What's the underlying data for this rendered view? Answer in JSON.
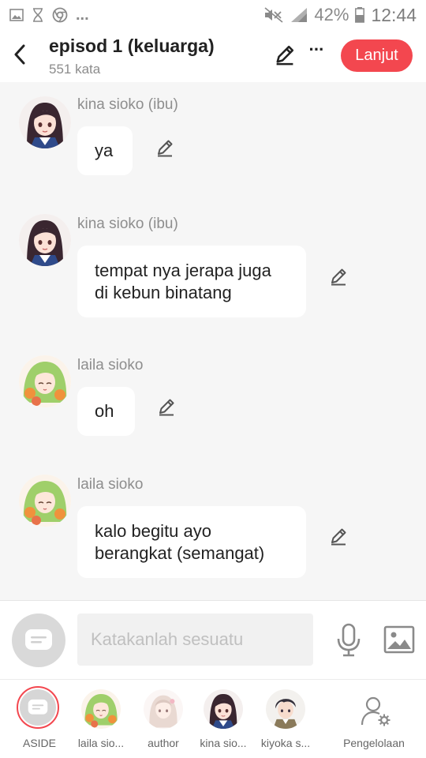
{
  "status_bar": {
    "battery": "42%",
    "time": "12:44",
    "more": "..."
  },
  "header": {
    "title": "episod 1 (keluarga)",
    "word_count": "551 kata",
    "more_label": "···",
    "next_label": "Lanjut",
    "accent_color": "#f3474f"
  },
  "messages": [
    {
      "sender": "kina sioko (ibu)",
      "text": "ya",
      "avatar": "dark-haired-girl-avatar"
    },
    {
      "sender": "kina sioko (ibu)",
      "text": "tempat nya jerapa juga\ndi kebun binatang",
      "avatar": "dark-haired-girl-avatar"
    },
    {
      "sender": "laila sioko",
      "text": "oh",
      "avatar": "green-haired-girl-avatar"
    },
    {
      "sender": "laila sioko",
      "text": "kalo begitu ayo\nberangkat  (semangat)",
      "avatar": "green-haired-girl-avatar"
    }
  ],
  "input": {
    "placeholder": "Katakanlah sesuatu"
  },
  "characters": [
    {
      "label": "ASIDE",
      "selected": true
    },
    {
      "label": "laila sio..."
    },
    {
      "label": "author"
    },
    {
      "label": "kina sio..."
    },
    {
      "label": "kiyoka s..."
    }
  ],
  "manage": {
    "label": "Pengelolaan"
  }
}
